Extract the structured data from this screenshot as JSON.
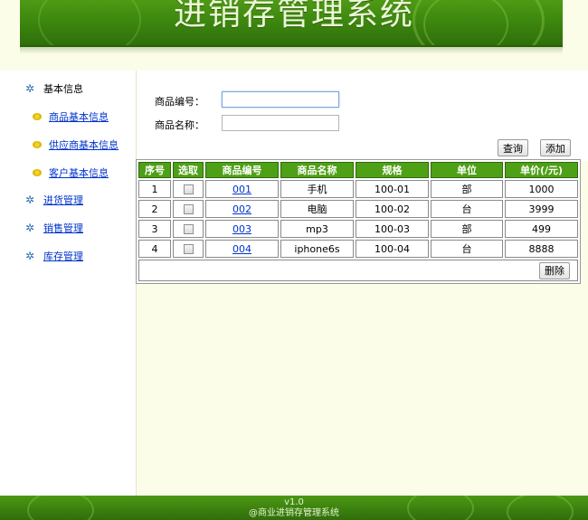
{
  "app": {
    "title": "进销存管理系统"
  },
  "sidebar": {
    "basic": {
      "label": "基本信息",
      "icon": "tree-icon"
    },
    "sub_items": [
      {
        "label": "商品基本信息"
      },
      {
        "label": "供应商基本信息"
      },
      {
        "label": "客户基本信息"
      }
    ],
    "purchase": {
      "label": "进货管理"
    },
    "sales": {
      "label": "销售管理"
    },
    "stock": {
      "label": "库存管理"
    }
  },
  "search": {
    "code_label": "商品编号：",
    "code_value": "",
    "name_label": "商品名称：",
    "name_value": "",
    "query_label": "查询",
    "add_label": "添加"
  },
  "table": {
    "headers": [
      "序号",
      "选取",
      "商品编号",
      "商品名称",
      "规格",
      "单位",
      "单价(/元)"
    ],
    "rows": [
      {
        "no": "1",
        "code": "001",
        "name": "手机",
        "spec": "100-01",
        "unit": "部",
        "price": "1000"
      },
      {
        "no": "2",
        "code": "002",
        "name": "电脑",
        "spec": "100-02",
        "unit": "台",
        "price": "3999"
      },
      {
        "no": "3",
        "code": "003",
        "name": "mp3",
        "spec": "100-03",
        "unit": "部",
        "price": "499"
      },
      {
        "no": "4",
        "code": "004",
        "name": "iphone6s",
        "spec": "100-04",
        "unit": "台",
        "price": "8888"
      }
    ],
    "delete_label": "删除"
  },
  "footer": {
    "version": "v1.0",
    "copyright": "@商业进销存管理系统"
  },
  "colors": {
    "accent_green": "#4ea016",
    "link_blue": "#0033cc",
    "content_bg": "#fbfde8"
  }
}
